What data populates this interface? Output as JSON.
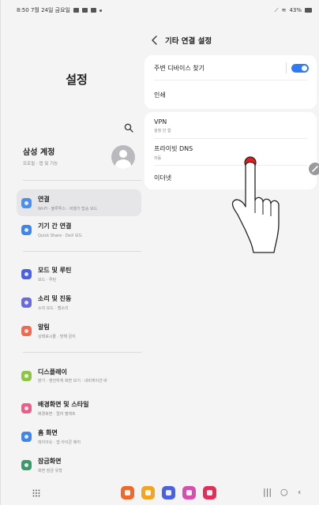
{
  "status_bar": {
    "time_date": "8:50 7월 24일 금요일",
    "battery": "43%"
  },
  "left": {
    "title": "설정",
    "account": {
      "title": "삼성 계정",
      "subtitle": "프로필 · 앱 및 기능"
    },
    "items": [
      {
        "label": "연결",
        "subtitle": "Wi-Fi · 블루투스 · 비행기 탑승 모드",
        "color": "#4a8ff0",
        "selected": true
      },
      {
        "label": "기기 간 연결",
        "subtitle": "Quick Share · DeX 모드",
        "color": "#3f86e8",
        "selected": false
      },
      {
        "label": "모드 및 루틴",
        "subtitle": "모드 · 루틴",
        "color": "#4a62e0",
        "selected": false
      },
      {
        "label": "소리 및 진동",
        "subtitle": "소리 모드 · 벨소리",
        "color": "#6a6ae0",
        "selected": false
      },
      {
        "label": "알림",
        "subtitle": "상태표시줄 · 방해 금지",
        "color": "#ef6a4f",
        "selected": false
      },
      {
        "label": "디스플레이",
        "subtitle": "밝기 · 편안하게 화면 보기 · 내비게이션 바",
        "color": "#8ec63f",
        "selected": false
      },
      {
        "label": "배경화면 및 스타일",
        "subtitle": "배경화면 · 컬러 팔레트",
        "color": "#e8608a",
        "selected": false
      },
      {
        "label": "홈 화면",
        "subtitle": "레이아웃 · 앱 아이콘 배지",
        "color": "#3f86e8",
        "selected": false
      },
      {
        "label": "잠금화면",
        "subtitle": "화면 잠금 유형",
        "color": "#3c9a6a",
        "selected": false
      }
    ]
  },
  "right": {
    "header_title": "기타 연결 설정",
    "card1": [
      {
        "title": "주변 디바이스 찾기",
        "toggle_on": true
      },
      {
        "title": "인쇄"
      }
    ],
    "card2": [
      {
        "title": "VPN",
        "subtitle": "설정 안 함"
      },
      {
        "title": "프라이빗 DNS",
        "subtitle": "자동"
      },
      {
        "title": "이더넷"
      }
    ]
  },
  "colors": {
    "accent": "#2f7bf5",
    "touch_point": "#e02020"
  },
  "dock_apps": [
    {
      "name": "app-1",
      "color": "#ef6a2a"
    },
    {
      "name": "app-2",
      "color": "#f3a51f"
    },
    {
      "name": "app-3",
      "color": "#4a62e0"
    },
    {
      "name": "app-4",
      "color": "#d64fb0"
    },
    {
      "name": "app-5",
      "color": "#e0305a"
    }
  ]
}
